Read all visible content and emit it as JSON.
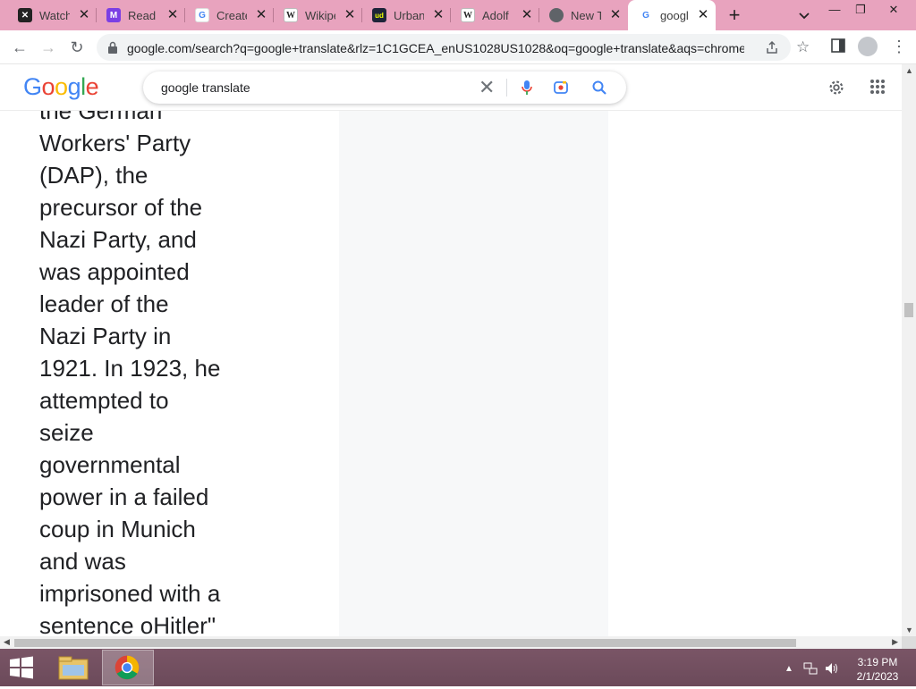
{
  "browser": {
    "tabs": [
      {
        "label": "Watch",
        "favicon": "x-icon",
        "color": "#222222"
      },
      {
        "label": "Read C",
        "favicon": "m-icon",
        "color": "#7b3fe4"
      },
      {
        "label": "Create",
        "favicon": "google-g-icon",
        "color": "#4285f4"
      },
      {
        "label": "Wikipe",
        "favicon": "wikipedia-icon",
        "color": "#333333"
      },
      {
        "label": "Urban",
        "favicon": "urban-dictionary-icon",
        "color": "#1d2439"
      },
      {
        "label": "Adolf H",
        "favicon": "wikipedia-icon",
        "color": "#333333"
      },
      {
        "label": "New Ta",
        "favicon": "chrome-icon",
        "color": "#5f6368"
      },
      {
        "label": "googl",
        "favicon": "google-g-icon",
        "color": "#4285f4",
        "active": true
      }
    ],
    "new_tab_symbol": "+",
    "url": "google.com/search?q=google+translate&rlz=1C1GCEA_enUS1028US1028&oq=google+translate&aqs=chrome...."
  },
  "google": {
    "logo_letters": [
      {
        "ch": "G",
        "color": "#4285f4"
      },
      {
        "ch": "o",
        "color": "#ea4335"
      },
      {
        "ch": "o",
        "color": "#fbbc05"
      },
      {
        "ch": "g",
        "color": "#4285f4"
      },
      {
        "ch": "l",
        "color": "#34a853"
      },
      {
        "ch": "e",
        "color": "#ea4335"
      }
    ],
    "search_query": "google translate"
  },
  "article": {
    "partial_top_line": "the German",
    "text": "Workers' Party\n(DAP), the\nprecursor of the\nNazi Party, and\nwas appointed\nleader of the\nNazi Party in\n1921. In 1923, he\nattempted to\nseize\ngovernmental\npower in a failed\ncoup in Munich\nand was\nimprisoned with a\nsentence oHitler\""
  },
  "taskbar": {
    "time": "3:19 PM",
    "date": "2/1/2023",
    "apps": [
      "file-explorer-icon",
      "chrome-icon"
    ]
  }
}
